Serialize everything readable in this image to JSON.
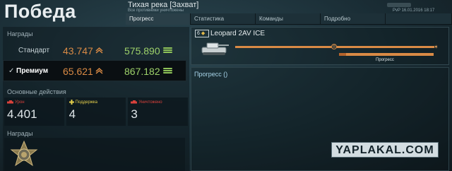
{
  "header": {
    "title": "Победа",
    "map_name": "Тихая река [Захват]",
    "map_subtitle": "Все противники уничтожены",
    "date": "РvP 16.01.2016 18:17"
  },
  "tabs": [
    {
      "label": "Прогресс",
      "active": true
    },
    {
      "label": "Статистика",
      "active": false
    },
    {
      "label": "Команды",
      "active": false
    },
    {
      "label": "Подробно",
      "active": false
    }
  ],
  "rewards": {
    "title": "Награды",
    "standard": {
      "label": "Стандарт",
      "credits": "43.747",
      "xp": "575.890"
    },
    "premium": {
      "label": "Премиум",
      "credits": "65.621",
      "xp": "867.182",
      "selected": true
    }
  },
  "actions": {
    "title": "Основные действия",
    "items": [
      {
        "label": "Урон",
        "value": "4.401",
        "color": "#d9413b",
        "icon": "damage-icon"
      },
      {
        "label": "Поддержка",
        "value": "4",
        "color": "#e6d04b",
        "icon": "support-icon"
      },
      {
        "label": "Уничтожено",
        "value": "3",
        "color": "#d9413b",
        "icon": "kill-icon"
      }
    ]
  },
  "awards": {
    "title": "Награды",
    "icon": "medal-icon"
  },
  "vehicle": {
    "tier": "6",
    "name": "Leopard 2AV ICE",
    "progress_label": "Прогресс"
  },
  "progress": {
    "title": "Прогресс ()"
  },
  "watermark": "YAPLAKAL.COM",
  "colors": {
    "credits": "#d98a45",
    "xp": "#9ed26a",
    "accent_blue": "#a9d5ea"
  }
}
